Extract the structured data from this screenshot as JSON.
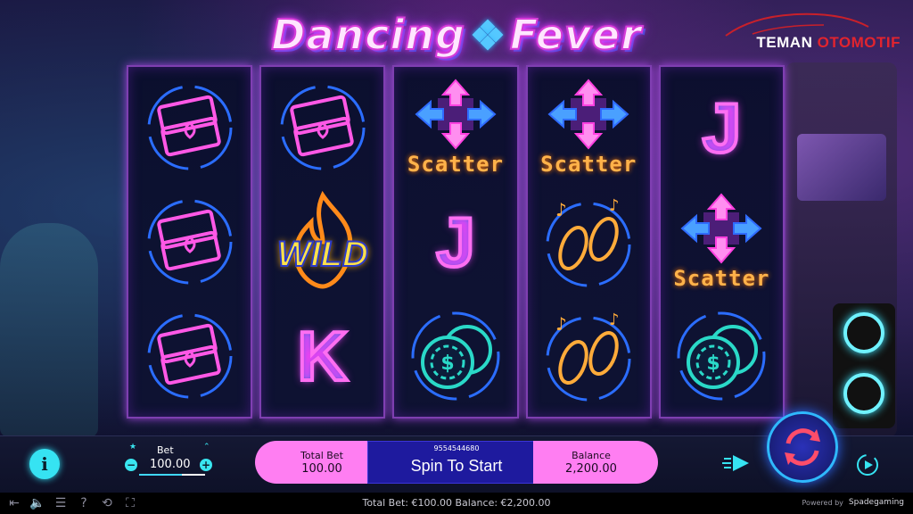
{
  "game": {
    "logo_word_1": "Dancing",
    "logo_word_2": "Fever"
  },
  "brand": {
    "part1": "TEMAN ",
    "part2": "OTOMOTIF"
  },
  "reels": [
    [
      "ticket",
      "ticket",
      "ticket"
    ],
    [
      "ticket",
      "wild",
      "K"
    ],
    [
      "scatter",
      "J",
      "chips"
    ],
    [
      "scatter",
      "shoes",
      "shoes"
    ],
    [
      "J",
      "scatter",
      "chips"
    ]
  ],
  "symbols": {
    "scatter_label": "Scatter",
    "wild_label": "WILD",
    "J_label": "J",
    "K_label": "K"
  },
  "controls": {
    "bet_label": "Bet",
    "bet_value": "100.00",
    "total_bet_label": "Total Bet",
    "total_bet_value": "100.00",
    "round_id": "9554544680",
    "spin_text": "Spin To Start",
    "balance_label": "Balance",
    "balance_value": "2,200.00"
  },
  "footer": {
    "summary": "Total Bet: €100.00  Balance: €2,200.00",
    "powered_by": "Powered by",
    "provider": "Spadegaming"
  },
  "colors": {
    "accent_pink": "#ff7ef2",
    "accent_cyan": "#36e3f2",
    "spin_panel": "#1e1a9e",
    "scatter_orange": "#ffb24a"
  }
}
